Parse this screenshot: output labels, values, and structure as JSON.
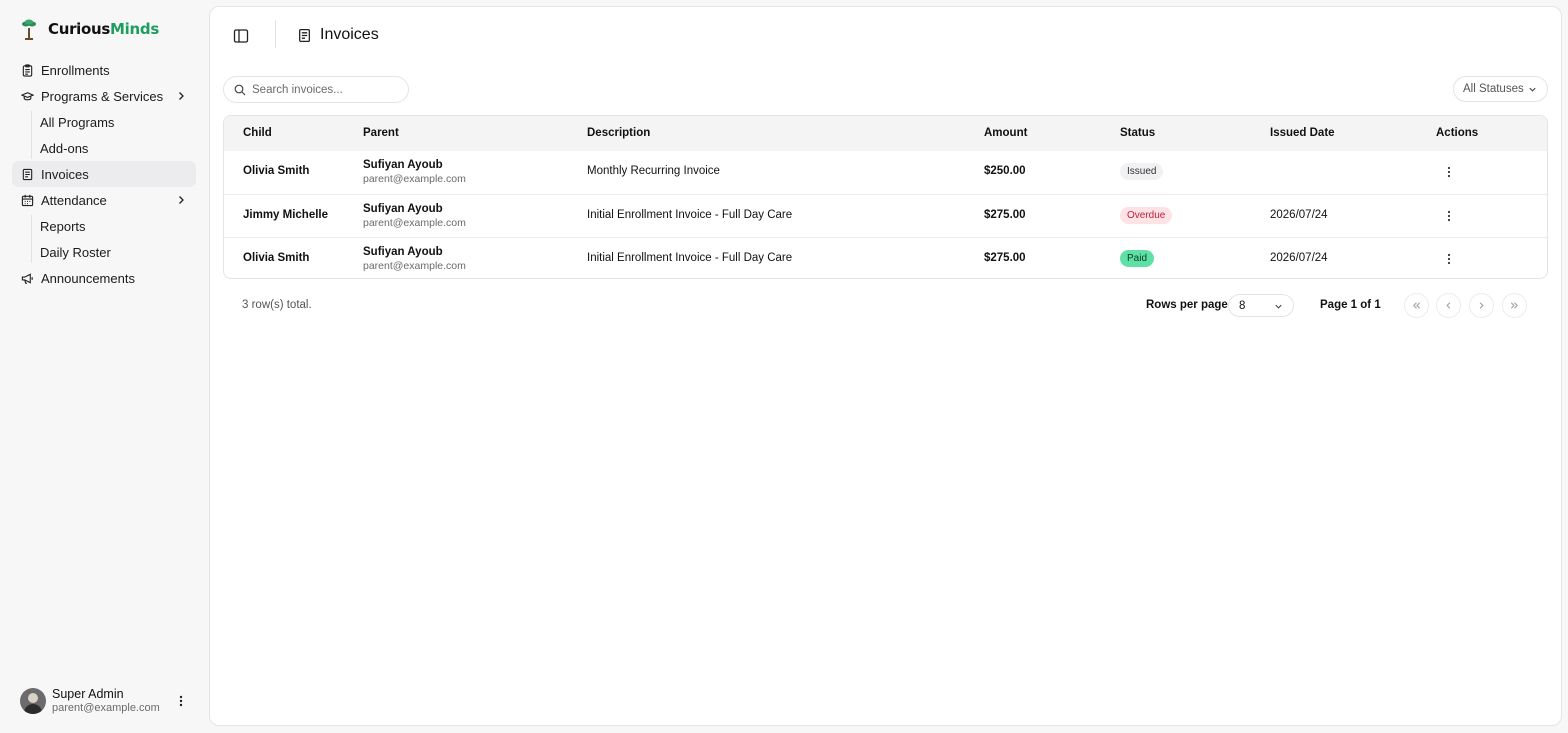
{
  "brand": {
    "part1": "Curious",
    "part2": "Minds",
    "color2": "#1e9e5e"
  },
  "sidebar": {
    "items": [
      {
        "label": "Enrollments",
        "icon": "clipboard-icon"
      },
      {
        "label": "Programs & Services",
        "icon": "graduation-cap-icon",
        "expandable": true
      },
      {
        "label": "All Programs",
        "sub": true
      },
      {
        "label": "Add-ons",
        "sub": true
      },
      {
        "label": "Invoices",
        "icon": "receipt-icon",
        "active": true
      },
      {
        "label": "Attendance",
        "icon": "calendar-icon",
        "expandable": true
      },
      {
        "label": "Reports",
        "sub": true
      },
      {
        "label": "Daily Roster",
        "sub": true
      },
      {
        "label": "Announcements",
        "icon": "megaphone-icon"
      }
    ]
  },
  "user": {
    "name": "Super Admin",
    "email": "parent@example.com"
  },
  "header": {
    "title": "Invoices"
  },
  "search": {
    "placeholder": "Search invoices..."
  },
  "filter": {
    "status_label": "All Statuses"
  },
  "table": {
    "columns": {
      "child": "Child",
      "parent": "Parent",
      "description": "Description",
      "amount": "Amount",
      "status": "Status",
      "issued_date": "Issued Date",
      "actions": "Actions"
    },
    "rows": [
      {
        "child": "Olivia Smith",
        "parent_name": "Sufiyan Ayoub",
        "parent_email": "parent@example.com",
        "description": "Monthly Recurring Invoice",
        "amount": "$250.00",
        "status": "Issued",
        "issued_date": ""
      },
      {
        "child": "Jimmy Michelle",
        "parent_name": "Sufiyan Ayoub",
        "parent_email": "parent@example.com",
        "description": "Initial Enrollment Invoice - Full Day Care",
        "amount": "$275.00",
        "status": "Overdue",
        "issued_date": "2026/07/24"
      },
      {
        "child": "Olivia Smith",
        "parent_name": "Sufiyan Ayoub",
        "parent_email": "parent@example.com",
        "description": "Initial Enrollment Invoice - Full Day Care",
        "amount": "$275.00",
        "status": "Paid",
        "issued_date": "2026/07/24"
      }
    ]
  },
  "status_colors": {
    "Issued": {
      "bg": "#f1f1f3",
      "fg": "#333333"
    },
    "Overdue": {
      "bg": "#fde2e6",
      "fg": "#c0223d"
    },
    "Paid": {
      "bg": "#5fe0a4",
      "fg": "#0b3d26"
    }
  },
  "footer": {
    "row_count": "3 row(s) total.",
    "rows_per_page_label": "Rows per page",
    "rows_per_page_value": "8",
    "page_label": "Page 1 of 1"
  }
}
